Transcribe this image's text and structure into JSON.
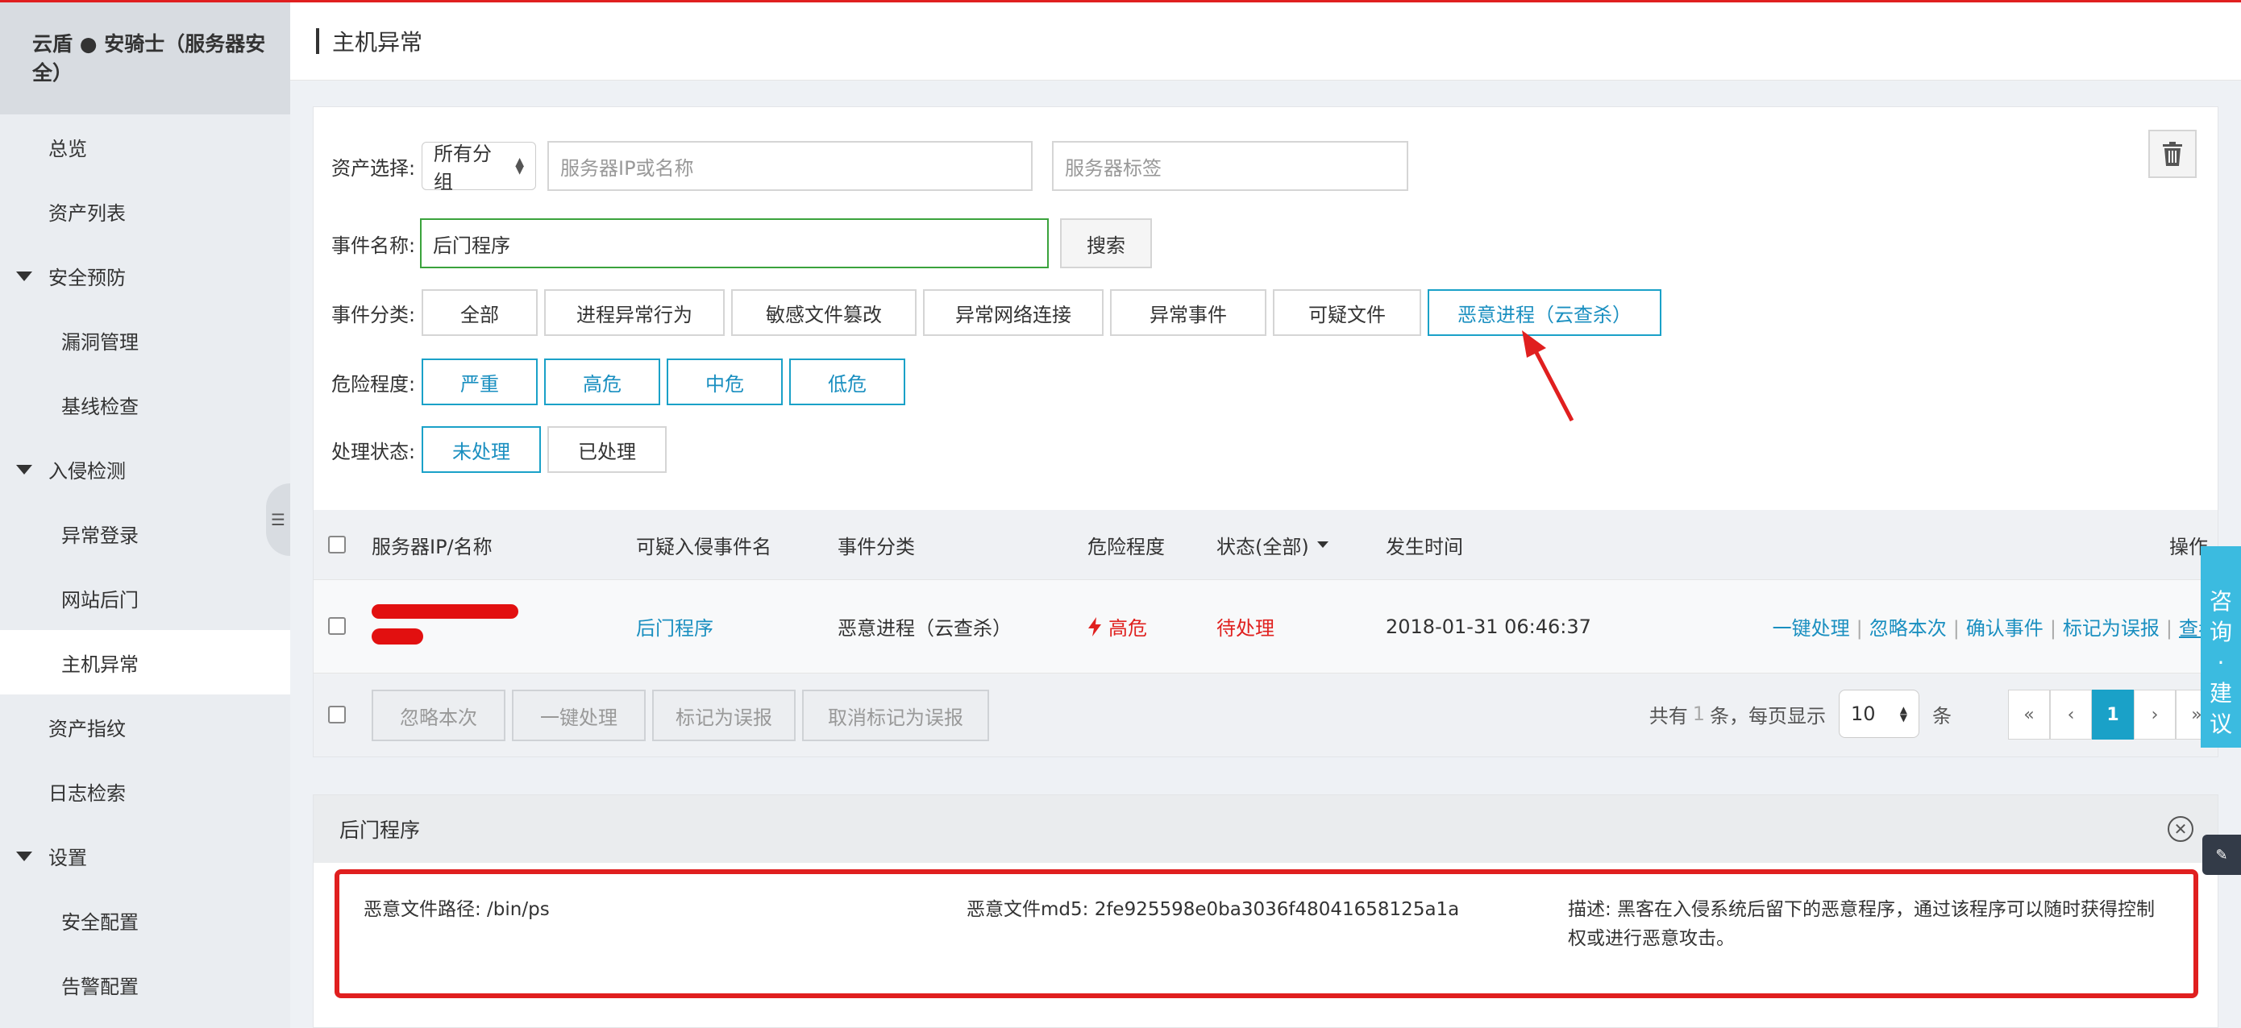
{
  "sidebar": {
    "brand": "云盾 ● 安骑士（服务器安全）",
    "items": [
      {
        "label": "总览",
        "level": "l1"
      },
      {
        "label": "资产列表",
        "level": "l1"
      },
      {
        "label": "安全预防",
        "level": "grp"
      },
      {
        "label": "漏洞管理",
        "level": "l2"
      },
      {
        "label": "基线检查",
        "level": "l2"
      },
      {
        "label": "入侵检测",
        "level": "grp"
      },
      {
        "label": "异常登录",
        "level": "l2"
      },
      {
        "label": "网站后门",
        "level": "l2"
      },
      {
        "label": "主机异常",
        "level": "l2",
        "active": true
      },
      {
        "label": "资产指纹",
        "level": "l1"
      },
      {
        "label": "日志检索",
        "level": "l1"
      },
      {
        "label": "设置",
        "level": "grp"
      },
      {
        "label": "安全配置",
        "level": "l2"
      },
      {
        "label": "告警配置",
        "level": "l2"
      }
    ]
  },
  "header": {
    "title": "主机异常"
  },
  "filters": {
    "asset_label": "资产选择:",
    "group_select": "所有分组",
    "server_ip_placeholder": "服务器IP或名称",
    "server_tag_placeholder": "服务器标签",
    "event_label": "事件名称:",
    "event_value": "后门程序",
    "search_button": "搜索",
    "category_label": "事件分类:",
    "categories": [
      "全部",
      "进程异常行为",
      "敏感文件篡改",
      "异常网络连接",
      "异常事件",
      "可疑文件",
      "恶意进程（云查杀）"
    ],
    "selected_category": "恶意进程（云查杀）",
    "severity_label": "危险程度:",
    "severities": [
      "严重",
      "高危",
      "中危",
      "低危"
    ],
    "status_label": "处理状态:",
    "statuses": [
      "未处理",
      "已处理"
    ],
    "selected_status": "未处理"
  },
  "table": {
    "headers": {
      "server": "服务器IP/名称",
      "event_name": "可疑入侵事件名",
      "category": "事件分类",
      "severity": "危险程度",
      "status": "状态(全部)",
      "time": "发生时间",
      "ops": "操作"
    },
    "rows": [
      {
        "event_name": "后门程序",
        "category": "恶意进程（云查杀）",
        "severity": "高危",
        "status": "待处理",
        "time": "2018-01-31 06:46:37",
        "ops": [
          "一键处理",
          "忽略本次",
          "确认事件",
          "标记为误报",
          "查看"
        ]
      }
    ],
    "bulk_buttons": [
      "忽略本次",
      "一键处理",
      "标记为误报",
      "取消标记为误报"
    ],
    "total_text_1": "共有",
    "total_count": "1",
    "total_text_2": "条，每页显示",
    "page_size": "10",
    "total_text_3": "条",
    "pager": {
      "first": "«",
      "prev": "‹",
      "current": "1",
      "next": "›",
      "last": "»"
    }
  },
  "detail": {
    "title": "后门程序",
    "path": "恶意文件路径: /bin/ps",
    "md5": "恶意文件md5: 2fe925598e0ba3036f48041658125a1a",
    "desc": "描述: 黑客在入侵系统后留下的恶意程序，通过该程序可以随时获得控制权或进行恶意攻击。"
  },
  "float": {
    "consult": [
      "咨",
      "询",
      "·",
      "建",
      "议"
    ]
  },
  "colors": {
    "accent": "#1aa1c8",
    "danger": "#e0211f",
    "annotation": "#e01f1f"
  }
}
